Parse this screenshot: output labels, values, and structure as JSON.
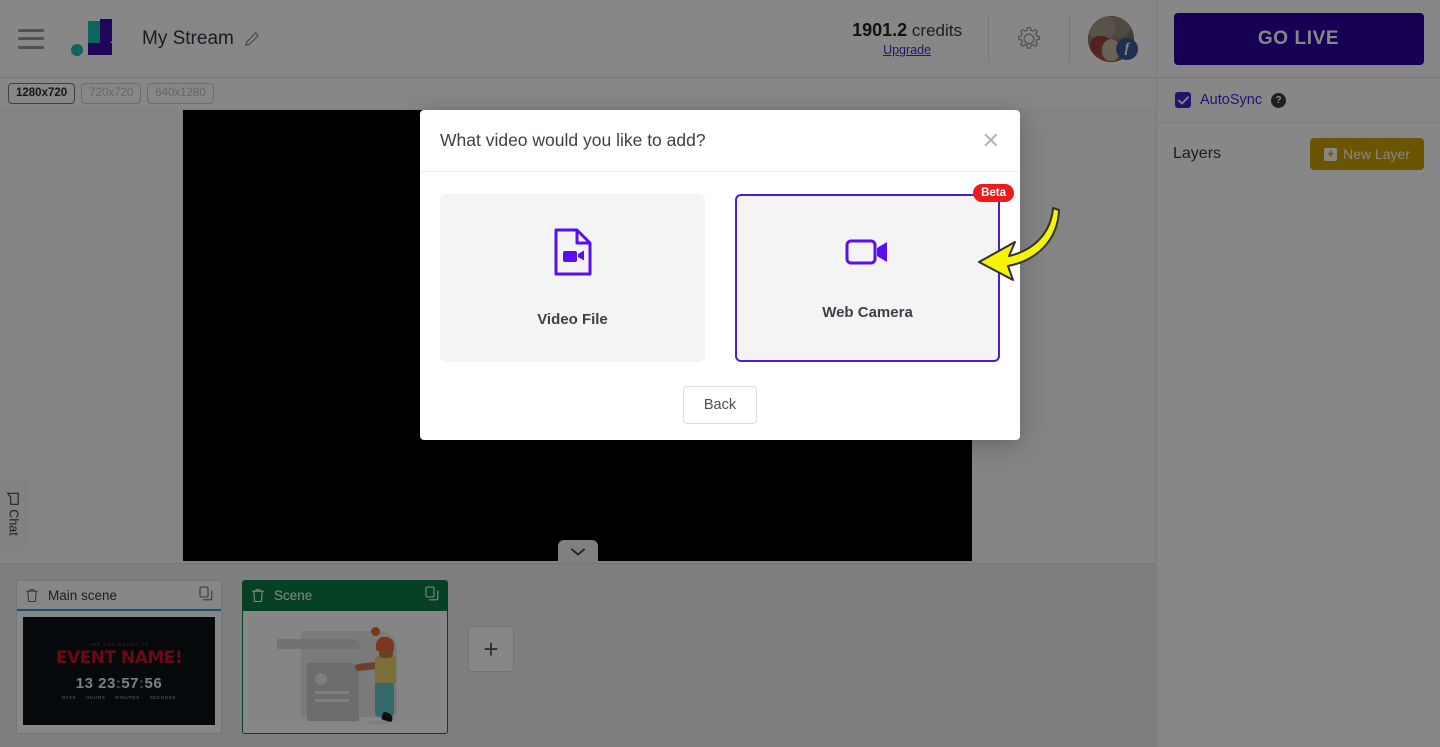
{
  "header": {
    "menu_icon": "hamburger-icon",
    "logo_icon": "app-logo",
    "stream_title": "My Stream",
    "edit_icon": "pencil-icon",
    "credits_value": "1901.2",
    "credits_label": "credits",
    "upgrade_label": "Upgrade",
    "settings_icon": "gear-icon",
    "avatar_icon": "user-avatar",
    "social_badge": "facebook-badge",
    "social_badge_glyph": "f"
  },
  "resolutions": [
    {
      "label": "1280x720",
      "selected": true
    },
    {
      "label": "720x720",
      "selected": false
    },
    {
      "label": "640x1280",
      "selected": false
    }
  ],
  "canvas": {
    "collapse_icon": "chevron-down-icon"
  },
  "chat_tab": {
    "label": "Chat",
    "icon": "chat-bubble-icon"
  },
  "scenes": {
    "items": [
      {
        "name": "Main scene",
        "active": false,
        "delete_icon": "trash-icon",
        "duplicate_icon": "copy-icon",
        "thumbnail": {
          "type": "countdown",
          "pretitle": "ARE YOU READY TO",
          "title": "EVENT NAME!",
          "days": "13",
          "hours": "23",
          "minutes": "57",
          "seconds": "56",
          "unit_days": "DAYS",
          "unit_hours": "HOURS",
          "unit_minutes": "MINUTES",
          "unit_seconds": "SECONDS"
        }
      },
      {
        "name": "Scene",
        "active": true,
        "delete_icon": "trash-icon",
        "duplicate_icon": "copy-icon",
        "thumbnail": {
          "type": "illustration"
        }
      }
    ],
    "add_label": "+"
  },
  "right_panel": {
    "go_live_label": "GO LIVE",
    "autosync_label": "AutoSync",
    "autosync_checked": true,
    "autosync_check_glyph": "✓",
    "help_glyph": "?",
    "layers_label": "Layers",
    "new_layer_label": "New Layer",
    "new_layer_plus": "+"
  },
  "modal": {
    "title": "What video would you like to add?",
    "close_glyph": "✕",
    "options": [
      {
        "label": "Video File",
        "icon": "video-file-icon",
        "selected": false,
        "badge": null
      },
      {
        "label": "Web Camera",
        "icon": "web-camera-icon",
        "selected": true,
        "badge": "Beta"
      }
    ],
    "back_label": "Back"
  },
  "colors": {
    "accent_purple": "#4a1fd0",
    "go_live": "#2b00a0",
    "new_layer_gold": "#caa006",
    "active_scene_green": "#0a7c40",
    "beta_red": "#ef1b1b",
    "annotation_yellow": "#f5f500"
  }
}
